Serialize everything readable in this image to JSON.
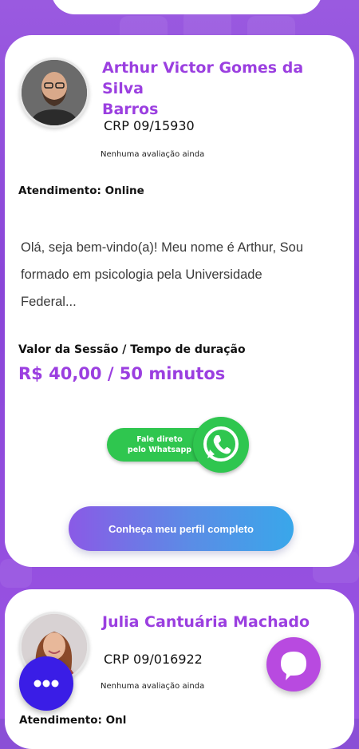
{
  "colors": {
    "background": "#8a45d8",
    "accent": "#9b3fe0",
    "whatsapp": "#2fc64f",
    "fab_menu": "#3a1de6",
    "fab_chat": "#b84ae0"
  },
  "profile_card": {
    "name": "Arthur Victor Gomes da Silva Barros",
    "name_line1": "Arthur Victor Gomes da Silva",
    "name_line2": "Barros",
    "crp": "CRP 09/15930",
    "rating": "Nenhuma avaliação ainda",
    "mode": "Atendimento: Online",
    "bio_line1": "Olá, seja bem-vindo(a)! Meu nome é Arthur, Sou",
    "bio_line2": "formado em psicologia pela Universidade",
    "bio_line3": "Federal...",
    "price_label": "Valor da Sessão / Tempo de duração",
    "price_value": "R$ 40,00 / 50 minutos",
    "whatsapp_line1": "Fale direto",
    "whatsapp_line2": "pelo Whatsapp",
    "cta": "Conheça meu perfil completo",
    "avatar_icon": "person-photo"
  },
  "next_card": {
    "name": "Julia Cantuária Machado",
    "crp": "CRP 09/016922",
    "rating": "Nenhuma avaliação ainda",
    "mode_cut": "Atendimento: Onl",
    "avatar_icon": "person-photo"
  },
  "fabs": {
    "menu_icon": "dots-icon",
    "chat_icon": "chat-bubble-icon"
  }
}
